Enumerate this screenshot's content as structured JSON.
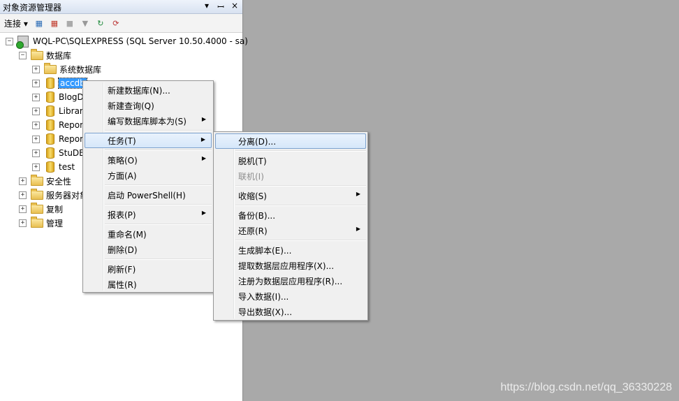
{
  "object_explorer": {
    "title": "对象资源管理器",
    "title_buttons": [
      "▾",
      "ꟷ",
      "×"
    ],
    "toolbar": {
      "connect_label": "连接"
    },
    "tree": {
      "server": "WQL-PC\\SQLEXPRESS (SQL Server 10.50.4000 - sa)",
      "databases": "数据库",
      "system_databases": "系统数据库",
      "db_items": [
        "accdb",
        "BlogD",
        "Librar",
        "Repor",
        "Repor",
        "StuDB",
        "test"
      ],
      "security": "安全性",
      "server_objects": "服务器对象",
      "replication": "复制",
      "management": "管理"
    }
  },
  "context_menu": {
    "items": [
      "新建数据库(N)...",
      "新建查询(Q)",
      "编写数据库脚本为(S)",
      "任务(T)",
      "策略(O)",
      "方面(A)",
      "启动 PowerShell(H)",
      "报表(P)",
      "重命名(M)",
      "删除(D)",
      "刷新(F)",
      "属性(R)"
    ]
  },
  "tasks_submenu": {
    "items": [
      "分离(D)...",
      "脱机(T)",
      "联机(I)",
      "收缩(S)",
      "备份(B)...",
      "还原(R)",
      "生成脚本(E)...",
      "提取数据层应用程序(X)...",
      "注册为数据层应用程序(R)...",
      "导入数据(I)...",
      "导出数据(X)..."
    ]
  },
  "watermark": "https://blog.csdn.net/qq_36330228"
}
